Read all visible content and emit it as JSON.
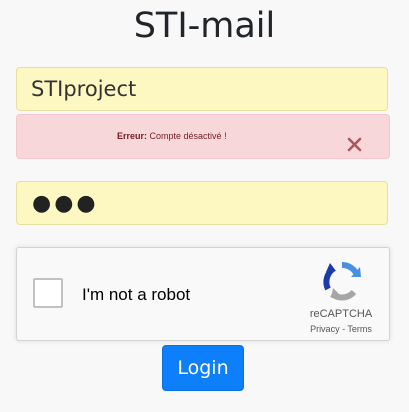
{
  "app": {
    "title": "STI-mail"
  },
  "form": {
    "username_value": "STIproject",
    "password_masked": "●●●",
    "login_label": "Login"
  },
  "alert": {
    "prefix": "Erreur:",
    "message": "Compte désactivé !",
    "close_icon": "close-icon",
    "close_glyph": "✕"
  },
  "recaptcha": {
    "label": "I'm not a robot",
    "brand": "reCAPTCHA",
    "privacy": "Privacy",
    "separator": " - ",
    "terms": "Terms",
    "icon": "recaptcha-logo-icon"
  },
  "colors": {
    "field_background": "#fdf7c1",
    "alert_background": "#f8d7da",
    "alert_text": "#721c24",
    "button_primary": "#0d7ffb",
    "recaptcha_blue": "#4a90e2",
    "recaptcha_dark_blue": "#1c3aa9",
    "recaptcha_gray": "#a6a6a6"
  }
}
